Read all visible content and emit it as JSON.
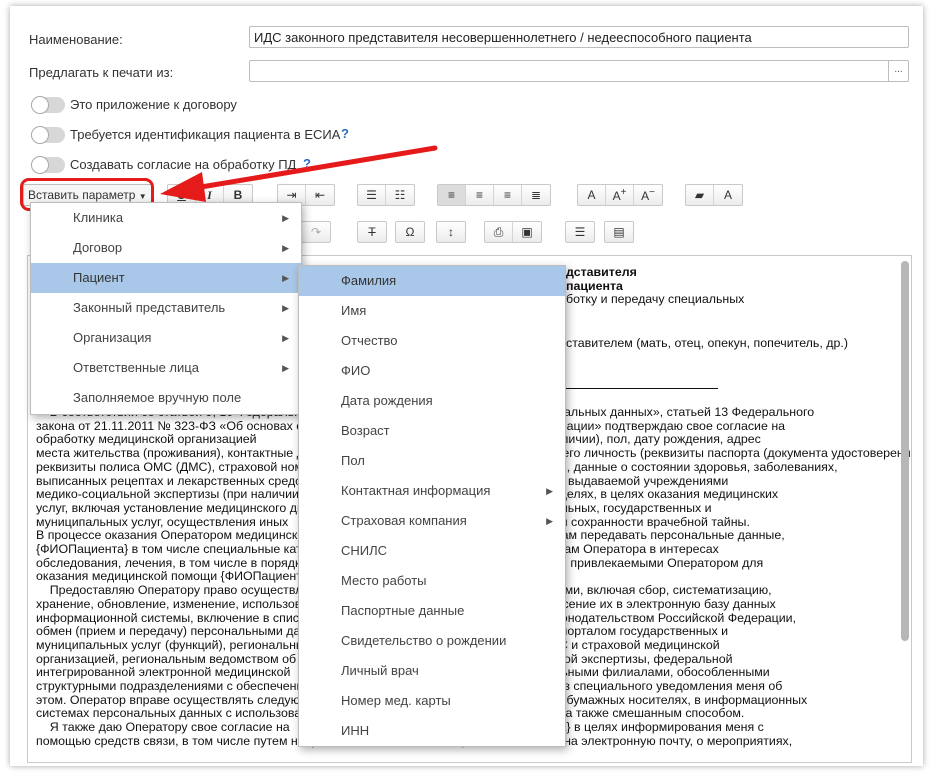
{
  "form": {
    "name_label": "Наименование:",
    "name_value": "ИДС законного представителя несовершеннолетнего / недееспособного пациента",
    "print_label": "Предлагать к печати из:",
    "print_value": "",
    "dots": "...",
    "toggles": [
      {
        "label": "Это приложение к договору",
        "help": ""
      },
      {
        "label": "Требуется идентификация пациента в ЕСИА",
        "help": "?"
      },
      {
        "label": "Создавать согласие на обработку ПД",
        "help": "?"
      }
    ]
  },
  "toolbar": {
    "insert_param": "Вставить параметр",
    "underline": "U",
    "italic": "I",
    "bold": "B",
    "font_bigger": "A",
    "font_smaller": "A",
    "font_plain": "A",
    "font_color": "A",
    "special_char": "Ω"
  },
  "menu1": {
    "items": [
      {
        "label": "Клиника",
        "sub": true
      },
      {
        "label": "Договор",
        "sub": true
      },
      {
        "label": "Пациент",
        "sub": true,
        "selected": true
      },
      {
        "label": "Законный представитель",
        "sub": true
      },
      {
        "label": "Организация",
        "sub": true
      },
      {
        "label": "Ответственные лица",
        "sub": true
      },
      {
        "label": "Заполняемое вручную поле",
        "sub": false
      }
    ]
  },
  "menu2": {
    "items": [
      {
        "label": "Фамилия",
        "sub": false,
        "selected": true
      },
      {
        "label": "Имя",
        "sub": false
      },
      {
        "label": "Отчество",
        "sub": false
      },
      {
        "label": "ФИО",
        "sub": false
      },
      {
        "label": "Дата рождения",
        "sub": false
      },
      {
        "label": "Возраст",
        "sub": false
      },
      {
        "label": "Пол",
        "sub": false
      },
      {
        "label": "Контактная информация",
        "sub": true
      },
      {
        "label": "Страховая компания",
        "sub": true
      },
      {
        "label": "СНИЛС",
        "sub": false
      },
      {
        "label": "Место работы",
        "sub": false
      },
      {
        "label": "Паспортные данные",
        "sub": false
      },
      {
        "label": "Свидетельство о рождении",
        "sub": false
      },
      {
        "label": "Личный врач",
        "sub": false
      },
      {
        "label": "Номер мед. карты",
        "sub": false
      },
      {
        "label": "ИНН",
        "sub": false
      }
    ]
  },
  "doc": {
    "right_lines": [
      "дставителя",
      "пациента",
      "ботку и передачу специальных",
      "",
      "",
      "ставителем (мать, отец, опекун, попечитель, др.)"
    ],
    "lines": [
      "    В соответствии со статьей 9, 10 Федерального закона от 27.07.2006 N 152-ФЗ «О персональных данных», статьей 13 Федерального",
      "закона от 21.11.2011 № 323-ФЗ «Об основах охраны здоровья граждан в Российской Федерации» подтверждаю свое согласие на",
      "обработку медицинской организацией                                                                    ство (при наличии), пол, дату рождения, адрес",
      "места жительства (проживания), контактные данные, реквизиты документа, удостоверяющего личность (реквизиты паспорта (документа удостоверения личности),",
      "реквизиты полиса ОМС (ДМС), страховой номер индивидуального лицевого счета (СНИЛС), данные о состоянии здоровья, заболеваниях,",
      "выписанных рецептах и лекарственных средствах, услугах, медицинской помощи, справки, выдаваемой учреждениями",
      "медико-социальной экспертизы (при наличии)                          в медико-профилактических целях, в целях оказания медицинских",
      "услуг, включая установление медицинского диагноза                                     тических, социальных, государственных и",
      "муниципальных услуг, осуществления иных                                                     зии обеспечения сохранности врачебной тайны.",
      "В процессе оказания Оператором медицинской помощи                                    ким работникам передавать персональные данные,",
      "{ФИОПациента} в том числе специальные категории                                         жностным лицам Оператора в интересах",
      "обследования, лечения, в том числе в порядке                                                 организациями, привлекаемыми Оператором для",
      "оказания медицинской помощи {ФИОПациента}",
      "    Предоставляю Оператору право осуществлять                                              льными данными, включая сбор, систематизацию,",
      "хранение, обновление, изменение, использование                                              тожение, внесение их в электронную базу данных",
      "информационной системы, включение в списки                                                    тренные законодательством Российской Федерации,",
      "обмен (прием и передачу) персональными данными                                               и Единым порталом государственных и",
      "муниципальных услуг (функций), региональными                                                 фондом ОМС и страховой медицинской",
      "организацией, региональным ведомством об                                                     дико-социальной экспертизы, федеральной",
      "интегрированной электронной медицинской                                                         его региональными филиалами, обособленными",
      "структурными подразделениями с обеспечением                                                    доступа, без специального уведомления меня об",
      "этом. Оператор вправе осуществлять следующие                                                   данных: на бумажных носителях, в информационных",
      "системах персональных данных с использованием                                                   атизации, а также смешанным способом.",
      "    Я также даю Оператору свое согласие на                                                        ФИОПациента} в целях информирования меня с",
      "помощью средств связи, в том числе путем направления мне SMS-сообщений или письма на электронную почту, о мероприятиях,"
    ]
  }
}
